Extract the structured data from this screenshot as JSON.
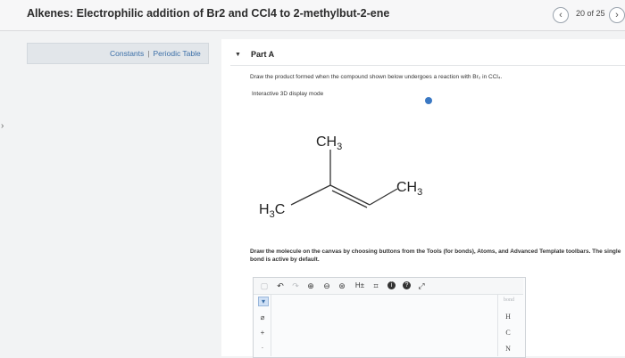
{
  "header": {
    "title": "Alkenes: Electrophilic addition of Br2 and CCl4 to 2-methylbut-2-ene",
    "counter": "20 of 25",
    "prev_icon": "chevron-left-icon",
    "next_icon": "chevron-right-icon",
    "prev_glyph": "‹",
    "next_glyph": "›"
  },
  "side": {
    "arrow_glyph": "›"
  },
  "resources": {
    "constants": "Constants",
    "separator": "|",
    "periodic_table": "Periodic Table"
  },
  "part": {
    "caret": "▼",
    "label": "Part A",
    "instruction": "Draw the product formed when the compound shown below undergoes a reaction with Br₂ in CCl₄.",
    "display_mode": "Interactive 3D display mode",
    "info_color": "#3a78c3"
  },
  "molecule": {
    "top_group": "CH",
    "top_sub": "3",
    "right_group": "CH",
    "right_sub": "3",
    "left_group": "H",
    "left_sub": "3",
    "left_tail": "C"
  },
  "canvas": {
    "instructions": "Draw the molecule on the canvas by choosing buttons from the Tools (for bonds), Atoms, and Advanced Template toolbars. The single bond is active by default."
  },
  "toolbar": {
    "undo": "↶",
    "redo": "↷",
    "zoom_in": "⊕",
    "zoom_out": "⊖",
    "zoom_fit": "⊛",
    "hydrogens": "H±",
    "template": "⌗",
    "info": "i",
    "help": "?",
    "expand": "⤢",
    "select_icon": "▢"
  },
  "left_tools": {
    "select": "▾",
    "eraser": "⌀",
    "charge_plus": "+",
    "more": "·"
  },
  "atoms": {
    "header": "bond",
    "items": [
      "H",
      "C",
      "N"
    ]
  },
  "colors": {
    "link": "#3b6fa8",
    "panel": "#e2e6ea",
    "background": "#f2f3f4"
  }
}
